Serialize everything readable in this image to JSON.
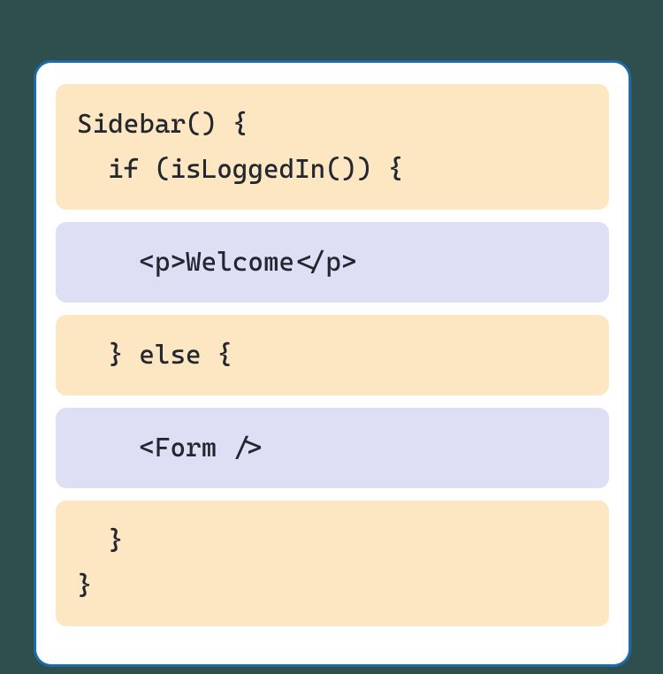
{
  "blocks": [
    {
      "kind": "js",
      "text": "Sidebar() {\n  if (isLoggedIn()) {"
    },
    {
      "kind": "jsx",
      "text": "    <p>Welcome</p>"
    },
    {
      "kind": "js",
      "text": "  } else {"
    },
    {
      "kind": "jsx",
      "text": "    <Form />"
    },
    {
      "kind": "js",
      "text": "  }\n}"
    }
  ]
}
